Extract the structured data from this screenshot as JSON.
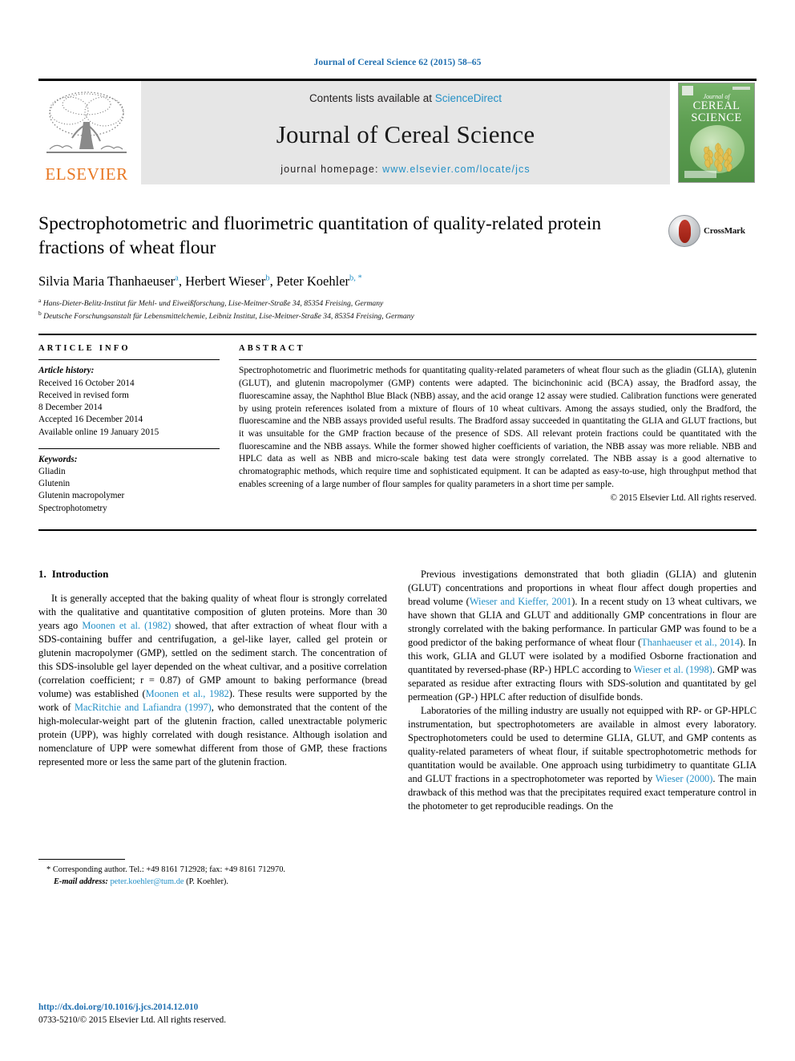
{
  "running_head": "Journal of Cereal Science 62 (2015) 58–65",
  "masthead": {
    "publisher_name": "ELSEVIER",
    "contents_prefix": "Contents lists available at ",
    "contents_link": "ScienceDirect",
    "journal_name": "Journal of Cereal Science",
    "homepage_prefix": "journal homepage: ",
    "homepage_url": "www.elsevier.com/locate/jcs",
    "cover": {
      "line1": "Journal of",
      "line2": "CEREAL",
      "line3": "SCIENCE"
    }
  },
  "article": {
    "title": "Spectrophotometric and fluorimetric quantitation of quality-related protein fractions of wheat flour",
    "authors": "Silvia Maria Thanhaeuser a, Herbert Wieser b, Peter Koehler b, *",
    "author_parts": [
      {
        "name": "Silvia Maria Thanhaeuser",
        "sup": "a",
        "sep": ", "
      },
      {
        "name": "Herbert Wieser",
        "sup": "b",
        "sep": ", "
      },
      {
        "name": "Peter Koehler",
        "sup": "b, *",
        "sep": ""
      }
    ],
    "affiliations": [
      {
        "sup": "a",
        "text": "Hans-Dieter-Belitz-Institut für Mehl- und Eiweißforschung, Lise-Meitner-Straße 34, 85354 Freising, Germany"
      },
      {
        "sup": "b",
        "text": "Deutsche Forschungsanstalt für Lebensmittelchemie, Leibniz Institut, Lise-Meitner-Straße 34, 85354 Freising, Germany"
      }
    ],
    "crossmark_label": "CrossMark"
  },
  "article_info": {
    "heading": "ARTICLE INFO",
    "history_label": "Article history:",
    "history": [
      "Received 16 October 2014",
      "Received in revised form",
      "8 December 2014",
      "Accepted 16 December 2014",
      "Available online 19 January 2015"
    ],
    "keywords_label": "Keywords:",
    "keywords": [
      "Gliadin",
      "Glutenin",
      "Glutenin macropolymer",
      "Spectrophotometry"
    ]
  },
  "abstract": {
    "heading": "ABSTRACT",
    "text": "Spectrophotometric and fluorimetric methods for quantitating quality-related parameters of wheat flour such as the gliadin (GLIA), glutenin (GLUT), and glutenin macropolymer (GMP) contents were adapted. The bicinchoninic acid (BCA) assay, the Bradford assay, the fluorescamine assay, the Naphthol Blue Black (NBB) assay, and the acid orange 12 assay were studied. Calibration functions were generated by using protein references isolated from a mixture of flours of 10 wheat cultivars. Among the assays studied, only the Bradford, the fluorescamine and the NBB assays provided useful results. The Bradford assay succeeded in quantitating the GLIA and GLUT fractions, but it was unsuitable for the GMP fraction because of the presence of SDS. All relevant protein fractions could be quantitated with the fluorescamine and the NBB assays. While the former showed higher coefficients of variation, the NBB assay was more reliable. NBB and HPLC data as well as NBB and micro-scale baking test data were strongly correlated. The NBB assay is a good alternative to chromatographic methods, which require time and sophisticated equipment. It can be adapted as easy-to-use, high throughput method that enables screening of a large number of flour samples for quality parameters in a short time per sample.",
    "copyright": "© 2015 Elsevier Ltd. All rights reserved."
  },
  "body": {
    "section_number": "1.",
    "section_title": "Introduction",
    "left_paragraphs": [
      {
        "segments": [
          {
            "t": "It is generally accepted that the baking quality of wheat flour is strongly correlated with the qualitative and quantitative composition of gluten proteins. More than 30 years ago ",
            "link": false
          },
          {
            "t": "Moonen et al. (1982)",
            "link": true
          },
          {
            "t": " showed, that after extraction of wheat flour with a SDS-containing buffer and centrifugation, a gel-like layer, called gel protein or glutenin macropolymer (GMP), settled on the sediment starch. The concentration of this SDS-insoluble gel layer depended on the wheat cultivar, and a positive correlation (correlation coefficient; r = 0.87) of GMP amount to baking performance (bread volume) was established (",
            "link": false
          },
          {
            "t": "Moonen et al., 1982",
            "link": true
          },
          {
            "t": "). These results were supported by the work of ",
            "link": false
          },
          {
            "t": "MacRitchie and Lafiandra (1997)",
            "link": true
          },
          {
            "t": ", who demonstrated that the content of the high-molecular-weight part of the glutenin fraction, called unextractable polymeric protein (UPP), was highly correlated with dough resistance. Although isolation and nomenclature of UPP were somewhat different from those of GMP, these fractions represented more or less the same part of the glutenin fraction.",
            "link": false
          }
        ]
      }
    ],
    "right_paragraphs": [
      {
        "segments": [
          {
            "t": "Previous investigations demonstrated that both gliadin (GLIA) and glutenin (GLUT) concentrations and proportions in wheat flour affect dough properties and bread volume (",
            "link": false
          },
          {
            "t": "Wieser and Kieffer, 2001",
            "link": true
          },
          {
            "t": "). In a recent study on 13 wheat cultivars, we have shown that GLIA and GLUT and additionally GMP concentrations in flour are strongly correlated with the baking performance. In particular GMP was found to be a good predictor of the baking performance of wheat flour (",
            "link": false
          },
          {
            "t": "Thanhaeuser et al., 2014",
            "link": true
          },
          {
            "t": "). In this work, GLIA and GLUT were isolated by a modified Osborne fractionation and quantitated by reversed-phase (RP-) HPLC according to ",
            "link": false
          },
          {
            "t": "Wieser et al. (1998)",
            "link": true
          },
          {
            "t": ". GMP was separated as residue after extracting flours with SDS-solution and quantitated by gel permeation (GP-) HPLC after reduction of disulfide bonds.",
            "link": false
          }
        ]
      },
      {
        "segments": [
          {
            "t": "Laboratories of the milling industry are usually not equipped with RP- or GP-HPLC instrumentation, but spectrophotometers are available in almost every laboratory. Spectrophotometers could be used to determine GLIA, GLUT, and GMP contents as quality-related parameters of wheat flour, if suitable spectrophotometric methods for quantitation would be available. One approach using turbidimetry to quantitate GLIA and GLUT fractions in a spectrophotometer was reported by ",
            "link": false
          },
          {
            "t": "Wieser (2000)",
            "link": true
          },
          {
            "t": ". The main drawback of this method was that the precipitates required exact temperature control in the photometer to get reproducible readings. On the",
            "link": false
          }
        ]
      }
    ]
  },
  "footnote": {
    "star": "*",
    "corresponding": "Corresponding author. Tel.: +49 8161 712928; fax: +49 8161 712970.",
    "email_label": "E-mail address:",
    "email": "peter.koehler@tum.de",
    "email_suffix": "(P. Koehler)."
  },
  "footer": {
    "doi": "http://dx.doi.org/10.1016/j.jcs.2014.12.010",
    "issn_line": "0733-5210/© 2015 Elsevier Ltd. All rights reserved."
  },
  "colors": {
    "link": "#2490c6",
    "running_head": "#1f6fb0",
    "elsevier_orange": "#E87722",
    "masthead_bg": "#e6e6e6"
  }
}
